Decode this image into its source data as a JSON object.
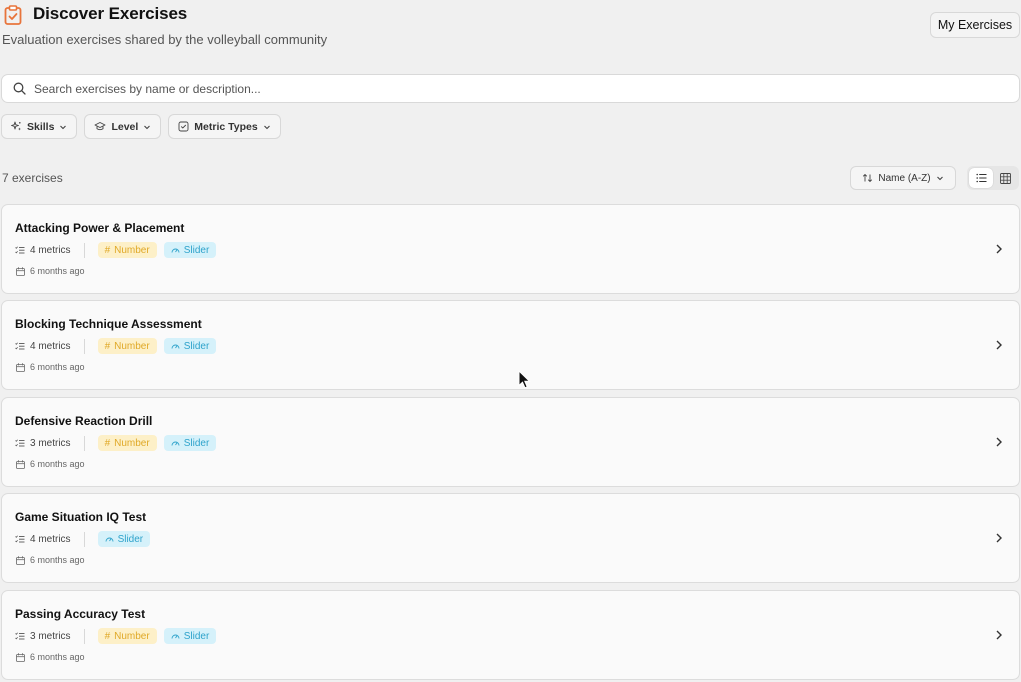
{
  "header": {
    "title": "Discover Exercises",
    "subtitle": "Evaluation exercises shared by the volleyball community",
    "my_exercises_label": "My Exercises",
    "icon": "clipboard-check-icon",
    "accent_color": "#e8743b"
  },
  "search": {
    "placeholder": "Search exercises by name or description...",
    "value": ""
  },
  "filters": [
    {
      "label": "Skills",
      "icon": "sparkles-icon"
    },
    {
      "label": "Level",
      "icon": "graduation-cap-icon"
    },
    {
      "label": "Metric Types",
      "icon": "checkbox-icon"
    }
  ],
  "toolbar": {
    "count_label": "7 exercises",
    "sort_label": "Name (A-Z)",
    "view_modes": [
      "list",
      "grid"
    ],
    "active_view": "list"
  },
  "exercises": [
    {
      "title": "Attacking Power & Placement",
      "metrics": "4 metrics",
      "types": [
        "Number",
        "Slider"
      ],
      "date": "6 months ago"
    },
    {
      "title": "Blocking Technique Assessment",
      "metrics": "4 metrics",
      "types": [
        "Number",
        "Slider"
      ],
      "date": "6 months ago"
    },
    {
      "title": "Defensive Reaction Drill",
      "metrics": "3 metrics",
      "types": [
        "Number",
        "Slider"
      ],
      "date": "6 months ago"
    },
    {
      "title": "Game Situation IQ Test",
      "metrics": "4 metrics",
      "types": [
        "Slider"
      ],
      "date": "6 months ago"
    },
    {
      "title": "Passing Accuracy Test",
      "metrics": "3 metrics",
      "types": [
        "Number",
        "Slider"
      ],
      "date": "6 months ago"
    }
  ],
  "colors": {
    "number_badge_bg": "#fdf0c8",
    "number_badge_text": "#e0a928",
    "slider_badge_bg": "#d5f1fa",
    "slider_badge_text": "#2fa3cb"
  }
}
